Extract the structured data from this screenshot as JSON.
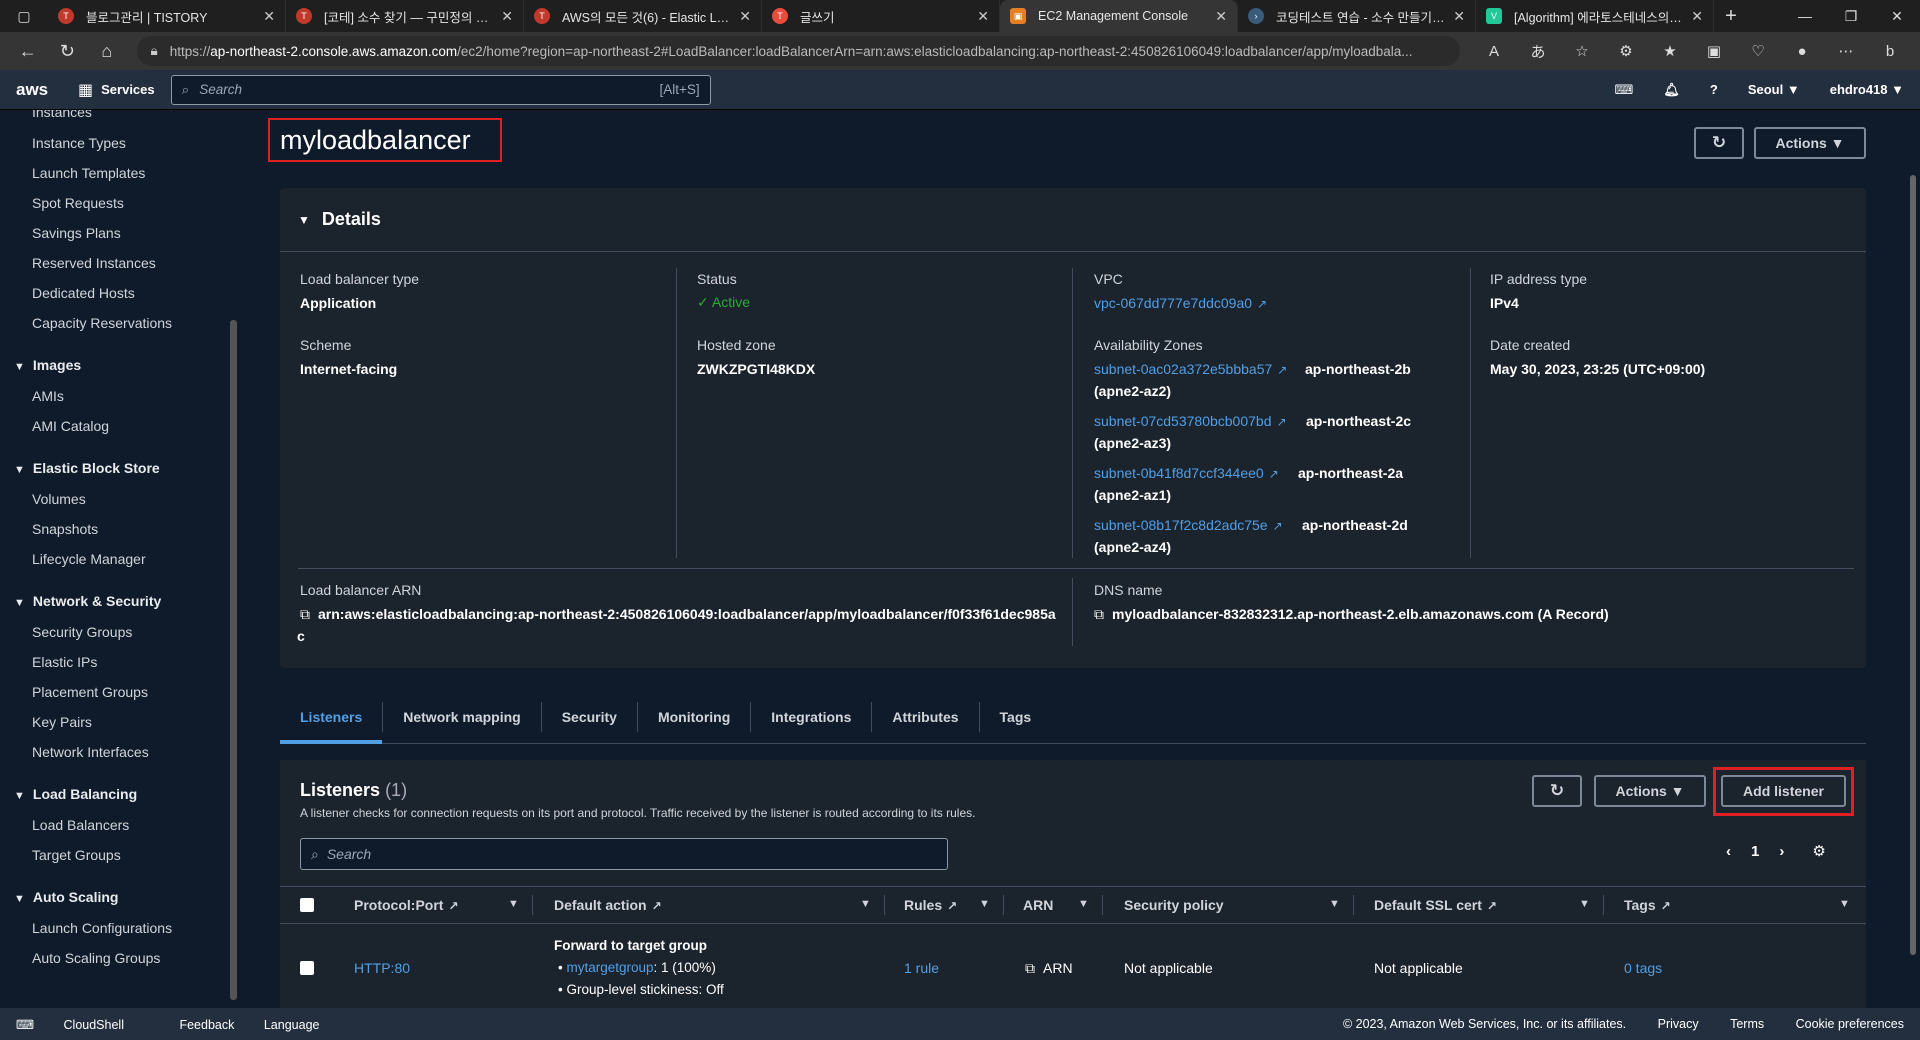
{
  "browser": {
    "tabs": [
      {
        "title": "블로그관리 | TISTORY"
      },
      {
        "title": "[코테] 소수 찾기 — 구민정의 개발"
      },
      {
        "title": "AWS의 모든 것(6) - Elastic Load"
      },
      {
        "title": "글쓰기"
      },
      {
        "title": "EC2 Management Console"
      },
      {
        "title": "코딩테스트 연습 - 소수 만들기 | 프"
      },
      {
        "title": "[Algorithm] 에라토스테네스의 체"
      }
    ],
    "url_prefix": "https://",
    "url_host": "ap-northeast-2.console.aws.amazon.com",
    "url_rest": "/ec2/home?region=ap-northeast-2#LoadBalancer:loadBalancerArn=arn:aws:elasticloadbalancing:ap-northeast-2:450826106049:loadbalancer/app/myloadbala..."
  },
  "aws": {
    "logo": "aws",
    "services": "Services",
    "search_placeholder": "Search",
    "search_shortcut": "[Alt+S]",
    "region": "Seoul ▼",
    "user": "ehdro418 ▼"
  },
  "sidebar": {
    "top_items": [
      "Instances",
      "Instance Types",
      "Launch Templates",
      "Spot Requests",
      "Savings Plans",
      "Reserved Instances",
      "Dedicated Hosts",
      "Capacity Reservations"
    ],
    "images": {
      "title": "Images",
      "items": [
        "AMIs",
        "AMI Catalog"
      ]
    },
    "ebs": {
      "title": "Elastic Block Store",
      "items": [
        "Volumes",
        "Snapshots",
        "Lifecycle Manager"
      ]
    },
    "network": {
      "title": "Network & Security",
      "items": [
        "Security Groups",
        "Elastic IPs",
        "Placement Groups",
        "Key Pairs",
        "Network Interfaces"
      ]
    },
    "lb": {
      "title": "Load Balancing",
      "items": [
        "Load Balancers",
        "Target Groups"
      ]
    },
    "asg": {
      "title": "Auto Scaling",
      "items": [
        "Launch Configurations",
        "Auto Scaling Groups"
      ]
    }
  },
  "page": {
    "title": "myloadbalancer",
    "actions": "Actions ▼"
  },
  "details": {
    "heading": "Details",
    "lb_type_label": "Load balancer type",
    "lb_type": "Application",
    "scheme_label": "Scheme",
    "scheme": "Internet-facing",
    "status_label": "Status",
    "status": "Active",
    "hosted_zone_label": "Hosted zone",
    "hosted_zone": "ZWKZPGTI48KDX",
    "vpc_label": "VPC",
    "vpc": "vpc-067dd777e7ddc09a0",
    "az_label": "Availability Zones",
    "azs": [
      {
        "subnet": "subnet-0ac02a372e5bbba57",
        "zone": "ap-northeast-2b",
        "id": "(apne2-az2)"
      },
      {
        "subnet": "subnet-07cd53780bcb007bd",
        "zone": "ap-northeast-2c",
        "id": "(apne2-az3)"
      },
      {
        "subnet": "subnet-0b41f8d7ccf344ee0",
        "zone": "ap-northeast-2a",
        "id": "(apne2-az1)"
      },
      {
        "subnet": "subnet-08b17f2c8d2adc75e",
        "zone": "ap-northeast-2d",
        "id": "(apne2-az4)"
      }
    ],
    "ip_type_label": "IP address type",
    "ip_type": "IPv4",
    "created_label": "Date created",
    "created": "May 30, 2023, 23:25 (UTC+09:00)",
    "arn_label": "Load balancer ARN",
    "arn": "arn:aws:elasticloadbalancing:ap-northeast-2:450826106049:loadbalancer/app/myloadbalancer/f0f33f61dec985a",
    "arn_tail": "c",
    "dns_label": "DNS name",
    "dns": "myloadbalancer-832832312.ap-northeast-2.elb.amazonaws.com (A Record)"
  },
  "tabs": [
    "Listeners",
    "Network mapping",
    "Security",
    "Monitoring",
    "Integrations",
    "Attributes",
    "Tags"
  ],
  "listeners": {
    "title": "Listeners",
    "count": "(1)",
    "desc": "A listener checks for connection requests on its port and protocol. Traffic received by the listener is routed according to its rules.",
    "actions": "Actions ▼",
    "add": "Add listener",
    "search_placeholder": "Search",
    "page": "1",
    "columns": [
      "Protocol:Port",
      "Default action",
      "Rules",
      "ARN",
      "Security policy",
      "Default SSL cert",
      "Tags"
    ],
    "row": {
      "protocol": "HTTP:80",
      "action_title": "Forward to target group",
      "tg": "mytargetgroup",
      "tg_weight": ": 1 (100%)",
      "stickiness": "Group-level stickiness: Off",
      "rules": "1 rule",
      "arn": "ARN",
      "policy": "Not applicable",
      "ssl": "Not applicable",
      "tags": "0 tags"
    }
  },
  "footer": {
    "cloudshell": "CloudShell",
    "feedback": "Feedback",
    "language": "Language",
    "copyright": "© 2023, Amazon Web Services, Inc. or its affiliates.",
    "privacy": "Privacy",
    "terms": "Terms",
    "cookies": "Cookie preferences"
  }
}
